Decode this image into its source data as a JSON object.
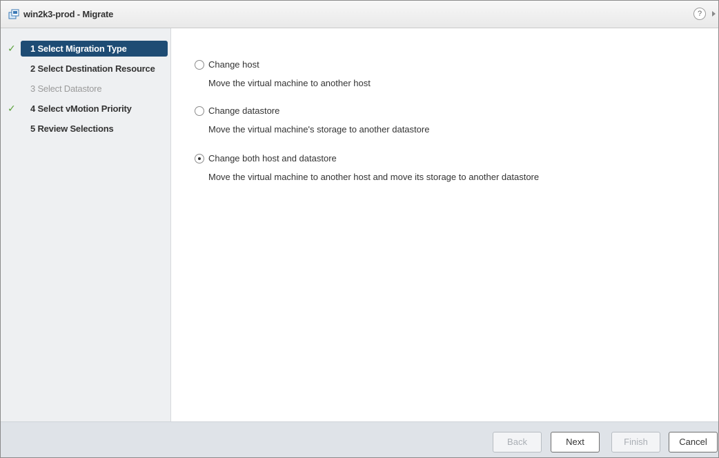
{
  "window": {
    "title": "win2k3-prod - Migrate",
    "icon": "virtual-machine-icon",
    "help_icon_label": "?"
  },
  "steps": [
    {
      "label": "1 Select Migration Type",
      "state": "active",
      "completed": true
    },
    {
      "label": "2 Select Destination Resource",
      "state": "normal",
      "completed": false
    },
    {
      "label": "3 Select Datastore",
      "state": "disabled",
      "completed": false
    },
    {
      "label": "4 Select vMotion Priority",
      "state": "normal",
      "completed": true
    },
    {
      "label": "5 Review Selections",
      "state": "normal",
      "completed": false
    }
  ],
  "check_mark": "✓",
  "options": [
    {
      "label": "Change host",
      "description": "Move the virtual machine to another host",
      "selected": false
    },
    {
      "label": "Change datastore",
      "description": "Move the virtual machine's storage to another datastore",
      "selected": false
    },
    {
      "label": "Change both host and datastore",
      "description": "Move the virtual machine to another host and move its storage to another datastore",
      "selected": true
    }
  ],
  "footer": {
    "back_label": "Back",
    "next_label": "Next",
    "finish_label": "Finish",
    "cancel_label": "Cancel",
    "back_enabled": false,
    "next_enabled": true,
    "finish_enabled": false,
    "cancel_enabled": true
  },
  "colors": {
    "accent": "#1e4c74",
    "check": "#5aa13a",
    "sidebar_bg": "#eef0f2",
    "footer_bg": "#dfe3e8"
  }
}
